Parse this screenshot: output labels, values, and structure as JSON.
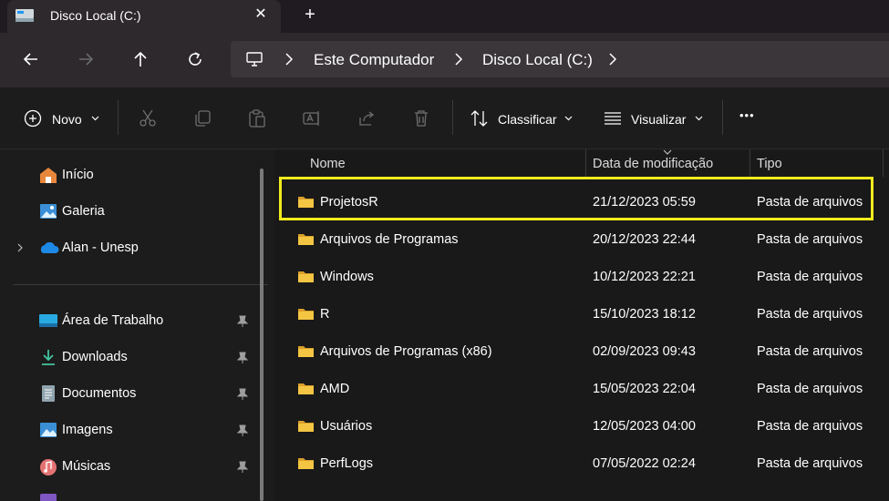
{
  "window": {
    "tab_title": "Disco Local (C:)",
    "tab_icon": "drive-icon",
    "close_glyph": "✕",
    "new_tab_glyph": "+"
  },
  "address": {
    "crumbs": [
      "Este Computador",
      "Disco Local (C:)"
    ]
  },
  "toolbar": {
    "new_label": "Novo",
    "sort_label": "Classificar",
    "view_label": "Visualizar",
    "more_glyph": "•••"
  },
  "sidebar": {
    "top_items": [
      {
        "label": "Início",
        "icon": "home-icon"
      },
      {
        "label": "Galeria",
        "icon": "gallery-icon"
      },
      {
        "label": "Alan - Unesp",
        "icon": "onedrive-icon"
      }
    ],
    "pinned_items": [
      {
        "label": "Área de Trabalho",
        "icon": "desktop-icon"
      },
      {
        "label": "Downloads",
        "icon": "download-icon"
      },
      {
        "label": "Documentos",
        "icon": "document-icon"
      },
      {
        "label": "Imagens",
        "icon": "images-icon"
      },
      {
        "label": "Músicas",
        "icon": "music-icon"
      }
    ]
  },
  "list": {
    "columns": {
      "name": "Nome",
      "date": "Data de modificação",
      "type": "Tipo"
    },
    "rows": [
      {
        "name": "ProjetosR",
        "date": "21/12/2023 05:59",
        "type": "Pasta de arquivos"
      },
      {
        "name": "Arquivos de Programas",
        "date": "20/12/2023 22:44",
        "type": "Pasta de arquivos"
      },
      {
        "name": "Windows",
        "date": "10/12/2023 22:21",
        "type": "Pasta de arquivos"
      },
      {
        "name": "R",
        "date": "15/10/2023 18:12",
        "type": "Pasta de arquivos"
      },
      {
        "name": "Arquivos de Programas (x86)",
        "date": "02/09/2023 09:43",
        "type": "Pasta de arquivos"
      },
      {
        "name": "AMD",
        "date": "15/05/2023 22:04",
        "type": "Pasta de arquivos"
      },
      {
        "name": "Usuários",
        "date": "12/05/2023 04:00",
        "type": "Pasta de arquivos"
      },
      {
        "name": "PerfLogs",
        "date": "07/05/2022 02:24",
        "type": "Pasta de arquivos"
      }
    ]
  },
  "colors": {
    "highlight": "#f2eb1c",
    "folder": "#f4c542",
    "accent": "#4cc2ff"
  }
}
